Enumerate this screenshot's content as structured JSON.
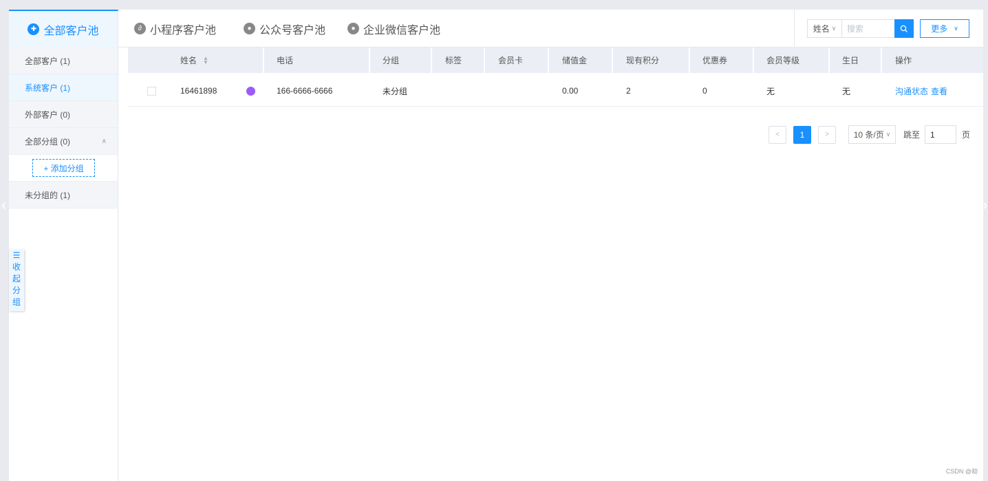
{
  "tabs": [
    {
      "label": "全部客户池",
      "icon": "grid-icon",
      "active": true
    },
    {
      "label": "小程序客户池",
      "icon": "miniapp-icon",
      "active": false
    },
    {
      "label": "公众号客户池",
      "icon": "user-icon",
      "active": false
    },
    {
      "label": "企业微信客户池",
      "icon": "chat-icon",
      "active": false
    }
  ],
  "toolbar": {
    "filter_select": "姓名",
    "search_placeholder": "搜索",
    "more_label": "更多"
  },
  "sidebar": {
    "items": [
      {
        "label": "全部客户 (1)"
      },
      {
        "label": "系统客户 (1)",
        "active": true
      },
      {
        "label": "外部客户 (0)"
      },
      {
        "label": "全部分组 (0)",
        "expanded": true
      }
    ],
    "add_group_label": "+ 添加分组",
    "ungrouped_label": "未分组的 (1)",
    "collapse_label": [
      "☰",
      "收",
      "起",
      "分",
      "组"
    ]
  },
  "table": {
    "columns": [
      "姓名",
      "电话",
      "分组",
      "标签",
      "会员卡",
      "储值金",
      "现有积分",
      "优惠券",
      "会员等级",
      "生日",
      "操作"
    ],
    "rows": [
      {
        "name": "16461898",
        "phone": "166-6666-6666",
        "group": "未分组",
        "tag": "",
        "card": "",
        "balance": "0.00",
        "points": "2",
        "coupons": "0",
        "level": "无",
        "birthday": "无",
        "action_status": "沟通状态",
        "action_view": "查看"
      }
    ]
  },
  "pagination": {
    "current": "1",
    "page_size": "10 条/页",
    "jump_label": "跳至",
    "jump_value": "1",
    "page_suffix": "页"
  },
  "credit": "CSDN @劫",
  "colors": {
    "accent": "#1890ff",
    "miniapp_badge": "#9b5cf5"
  }
}
